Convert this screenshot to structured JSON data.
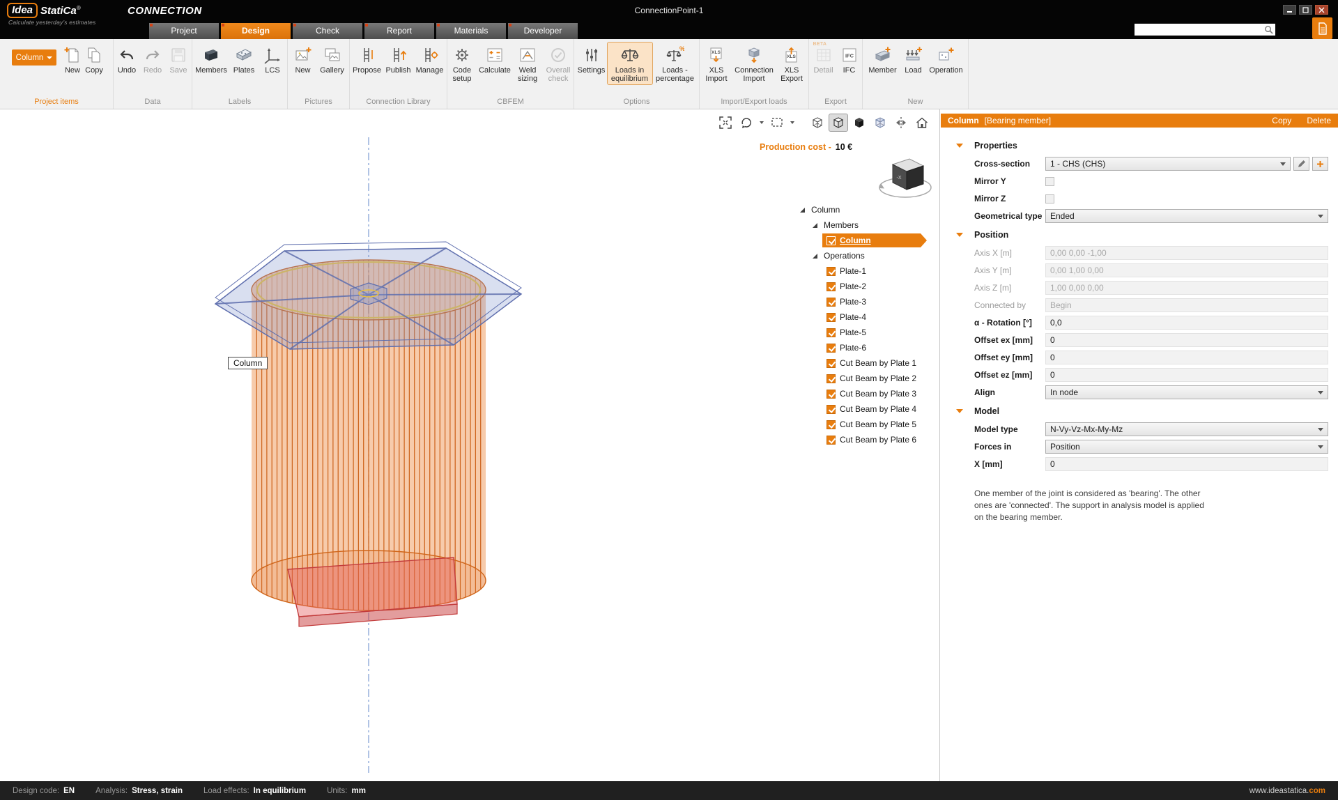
{
  "colors": {
    "accent": "#e87d0e",
    "cylinder": "#cf6418",
    "plate_blue": "#5f6fae",
    "plate_red": "#c23b3b"
  },
  "titlebar": {
    "logo_text": "Idea",
    "logo_suffix": "StatiCa",
    "logo_reg": "®",
    "tagline": "Calculate yesterday's estimates",
    "app_name": "CONNECTION",
    "document_title": "ConnectionPoint-1"
  },
  "tabs": [
    {
      "label": "Project"
    },
    {
      "label": "Design"
    },
    {
      "label": "Check"
    },
    {
      "label": "Report"
    },
    {
      "label": "Materials"
    },
    {
      "label": "Developer"
    }
  ],
  "search": {
    "value": "",
    "placeholder": ""
  },
  "ribbon": {
    "project_items": {
      "group_label": "Project items",
      "column_button": "Column",
      "new": "New",
      "copy": "Copy"
    },
    "data": {
      "group_label": "Data",
      "undo": "Undo",
      "redo": "Redo",
      "save": "Save"
    },
    "labels": {
      "group_label": "Labels",
      "members": "Members",
      "plates": "Plates",
      "lcs": "LCS"
    },
    "pictures": {
      "group_label": "Pictures",
      "new": "New",
      "gallery": "Gallery"
    },
    "connection_library": {
      "group_label": "Connection Library",
      "propose": "Propose",
      "publish": "Publish",
      "manage": "Manage"
    },
    "cbfem": {
      "group_label": "CBFEM",
      "code_setup": "Code setup",
      "calculate": "Calculate",
      "weld_sizing": "Weld sizing",
      "overall_check": "Overall check"
    },
    "options": {
      "group_label": "Options",
      "settings": "Settings",
      "loads_eq": "Loads in equilibrium",
      "loads_pct": "Loads - percentage"
    },
    "import_export": {
      "group_label": "Import/Export loads",
      "xls_import": "XLS Import",
      "conn_import": "Connection Import",
      "xls_export": "XLS Export"
    },
    "export": {
      "group_label": "Export",
      "detail": "Detail",
      "detail_badge": "BETA",
      "ifc": "IFC"
    },
    "new": {
      "group_label": "New",
      "member": "Member",
      "load": "Load",
      "operation": "Operation"
    }
  },
  "viewport": {
    "production_cost_label": "Production cost -",
    "production_cost_value": "10 €",
    "column_tag": "Column",
    "nav_cube_face": "-X"
  },
  "tree": {
    "root": "Column",
    "members_group": "Members",
    "member_item": "Column",
    "operations_group": "Operations",
    "operations": [
      {
        "label": "Plate-1"
      },
      {
        "label": "Plate-2"
      },
      {
        "label": "Plate-3"
      },
      {
        "label": "Plate-4"
      },
      {
        "label": "Plate-5"
      },
      {
        "label": "Plate-6"
      },
      {
        "label": "Cut Beam by Plate 1"
      },
      {
        "label": "Cut Beam by Plate 2"
      },
      {
        "label": "Cut Beam by Plate 3"
      },
      {
        "label": "Cut Beam by Plate 4"
      },
      {
        "label": "Cut Beam by Plate 5"
      },
      {
        "label": "Cut Beam by Plate 6"
      }
    ]
  },
  "panel": {
    "header": {
      "title": "Column",
      "subtitle": "[Bearing member]",
      "copy": "Copy",
      "delete": "Delete"
    },
    "properties_section": "Properties",
    "position_section": "Position",
    "model_section": "Model",
    "fields": {
      "cross_section": {
        "label": "Cross-section",
        "value": "1 - CHS (CHS)"
      },
      "mirror_y": {
        "label": "Mirror Y"
      },
      "mirror_z": {
        "label": "Mirror Z"
      },
      "geometrical_type": {
        "label": "Geometrical type",
        "value": "Ended"
      },
      "axis_x": {
        "label": "Axis X [m]",
        "value": "0,00 0,00 -1,00"
      },
      "axis_y": {
        "label": "Axis Y [m]",
        "value": "0,00 1,00 0,00"
      },
      "axis_z": {
        "label": "Axis Z [m]",
        "value": "1,00 0,00 0,00"
      },
      "connected_by": {
        "label": "Connected by",
        "value": "Begin"
      },
      "rotation": {
        "label": "α - Rotation [°]",
        "value": "0,0"
      },
      "offset_ex": {
        "label": "Offset ex [mm]",
        "value": "0"
      },
      "offset_ey": {
        "label": "Offset ey [mm]",
        "value": "0"
      },
      "offset_ez": {
        "label": "Offset ez [mm]",
        "value": "0"
      },
      "align": {
        "label": "Align",
        "value": "In node"
      },
      "model_type": {
        "label": "Model type",
        "value": "N-Vy-Vz-Mx-My-Mz"
      },
      "forces_in": {
        "label": "Forces in",
        "value": "Position"
      },
      "x": {
        "label": "X [mm]",
        "value": "0"
      }
    },
    "help_text": "One member of the joint is considered as 'bearing'. The other ones are 'connected'. The support in analysis model is applied on the bearing member."
  },
  "statusbar": {
    "design_code_label": "Design code:",
    "design_code_value": "EN",
    "analysis_label": "Analysis:",
    "analysis_value": "Stress, strain",
    "load_effects_label": "Load effects:",
    "load_effects_value": "In equilibrium",
    "units_label": "Units:",
    "units_value": "mm",
    "website": "www.ideastatica.",
    "website_tld": "com"
  }
}
